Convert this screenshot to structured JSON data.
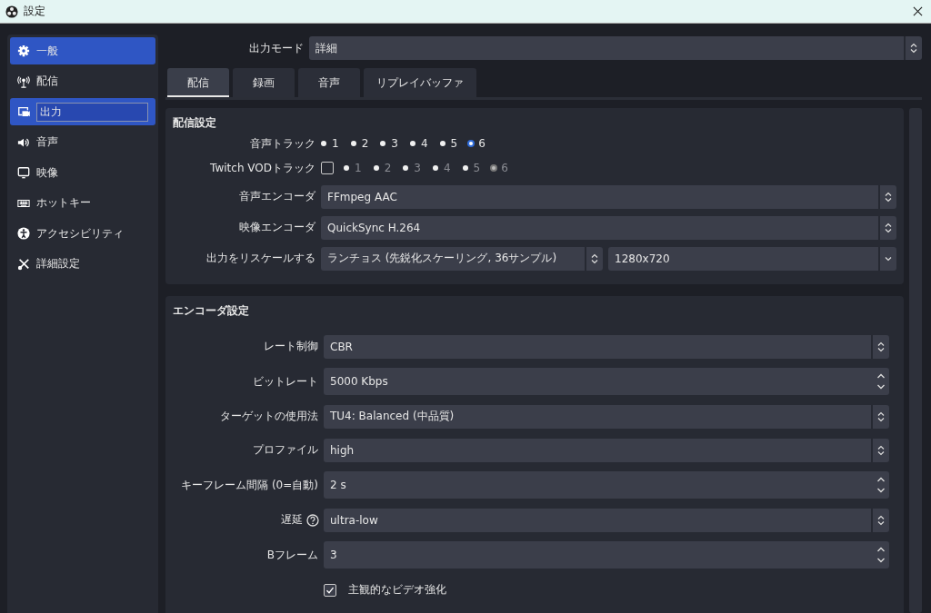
{
  "window": {
    "title": "設定"
  },
  "sidebar": {
    "items": [
      {
        "label": "一般",
        "selected": true,
        "editing": false
      },
      {
        "label": "配信",
        "selected": false,
        "editing": false
      },
      {
        "label": "出力",
        "selected": true,
        "editing": true
      },
      {
        "label": "音声",
        "selected": false,
        "editing": false
      },
      {
        "label": "映像",
        "selected": false,
        "editing": false
      },
      {
        "label": "ホットキー",
        "selected": false,
        "editing": false
      },
      {
        "label": "アクセシビリティ",
        "selected": false,
        "editing": false
      },
      {
        "label": "詳細設定",
        "selected": false,
        "editing": false
      }
    ]
  },
  "output_mode": {
    "label": "出力モード",
    "value": "詳細"
  },
  "tabs": [
    {
      "label": "配信",
      "selected": true
    },
    {
      "label": "録画",
      "selected": false
    },
    {
      "label": "音声",
      "selected": false
    },
    {
      "label": "リプレイバッファ",
      "selected": false
    }
  ],
  "streaming": {
    "title": "配信設定",
    "track_rows": [
      {
        "label": "音声トラック",
        "disabled": false,
        "options": [
          {
            "label": "1",
            "selected": false
          },
          {
            "label": "2",
            "selected": false
          },
          {
            "label": "3",
            "selected": false
          },
          {
            "label": "4",
            "selected": false
          },
          {
            "label": "5",
            "selected": false
          },
          {
            "label": "6",
            "selected": true
          }
        ]
      },
      {
        "label": "Twitch VODトラック",
        "checkbox": {
          "checked": false
        },
        "disabled": true,
        "options": [
          {
            "label": "1",
            "selected": false
          },
          {
            "label": "2",
            "selected": false
          },
          {
            "label": "3",
            "selected": false
          },
          {
            "label": "4",
            "selected": false
          },
          {
            "label": "5",
            "selected": false
          },
          {
            "label": "6",
            "selected": true
          }
        ]
      }
    ],
    "rows": [
      {
        "label": "音声エンコーダ",
        "fields": [
          {
            "kind": "combo",
            "value": "FFmpeg AAC"
          }
        ]
      },
      {
        "label": "映像エンコーダ",
        "fields": [
          {
            "kind": "combo",
            "value": "QuickSync H.264"
          }
        ]
      },
      {
        "label": "出力をリスケールする",
        "fields": [
          {
            "kind": "combo",
            "value": "ランチョス (先鋭化スケーリング, 36サンプル)"
          },
          {
            "kind": "dropdown",
            "value": "1280x720"
          }
        ]
      }
    ]
  },
  "encoder": {
    "title": "エンコーダ設定",
    "rows": [
      {
        "label": "レート制御",
        "fields": [
          {
            "kind": "combo",
            "value": "CBR"
          }
        ]
      },
      {
        "label": "ビットレート",
        "fields": [
          {
            "kind": "spin",
            "value": "5000 Kbps"
          }
        ]
      },
      {
        "label": "ターゲットの使用法",
        "fields": [
          {
            "kind": "combo",
            "value": "TU4: Balanced (中品質)"
          }
        ]
      },
      {
        "label": "プロファイル",
        "fields": [
          {
            "kind": "combo",
            "value": "high"
          }
        ]
      },
      {
        "label": "キーフレーム間隔 (0=自動)",
        "fields": [
          {
            "kind": "spin",
            "value": "2 s"
          }
        ]
      },
      {
        "label": "遅延",
        "help": true,
        "fields": [
          {
            "kind": "combo",
            "value": "ultra-low"
          }
        ]
      },
      {
        "label": "Bフレーム",
        "fields": [
          {
            "kind": "spin",
            "value": "3"
          }
        ]
      }
    ],
    "checkbox": {
      "label": "主観的なビデオ強化",
      "checked": true
    }
  }
}
